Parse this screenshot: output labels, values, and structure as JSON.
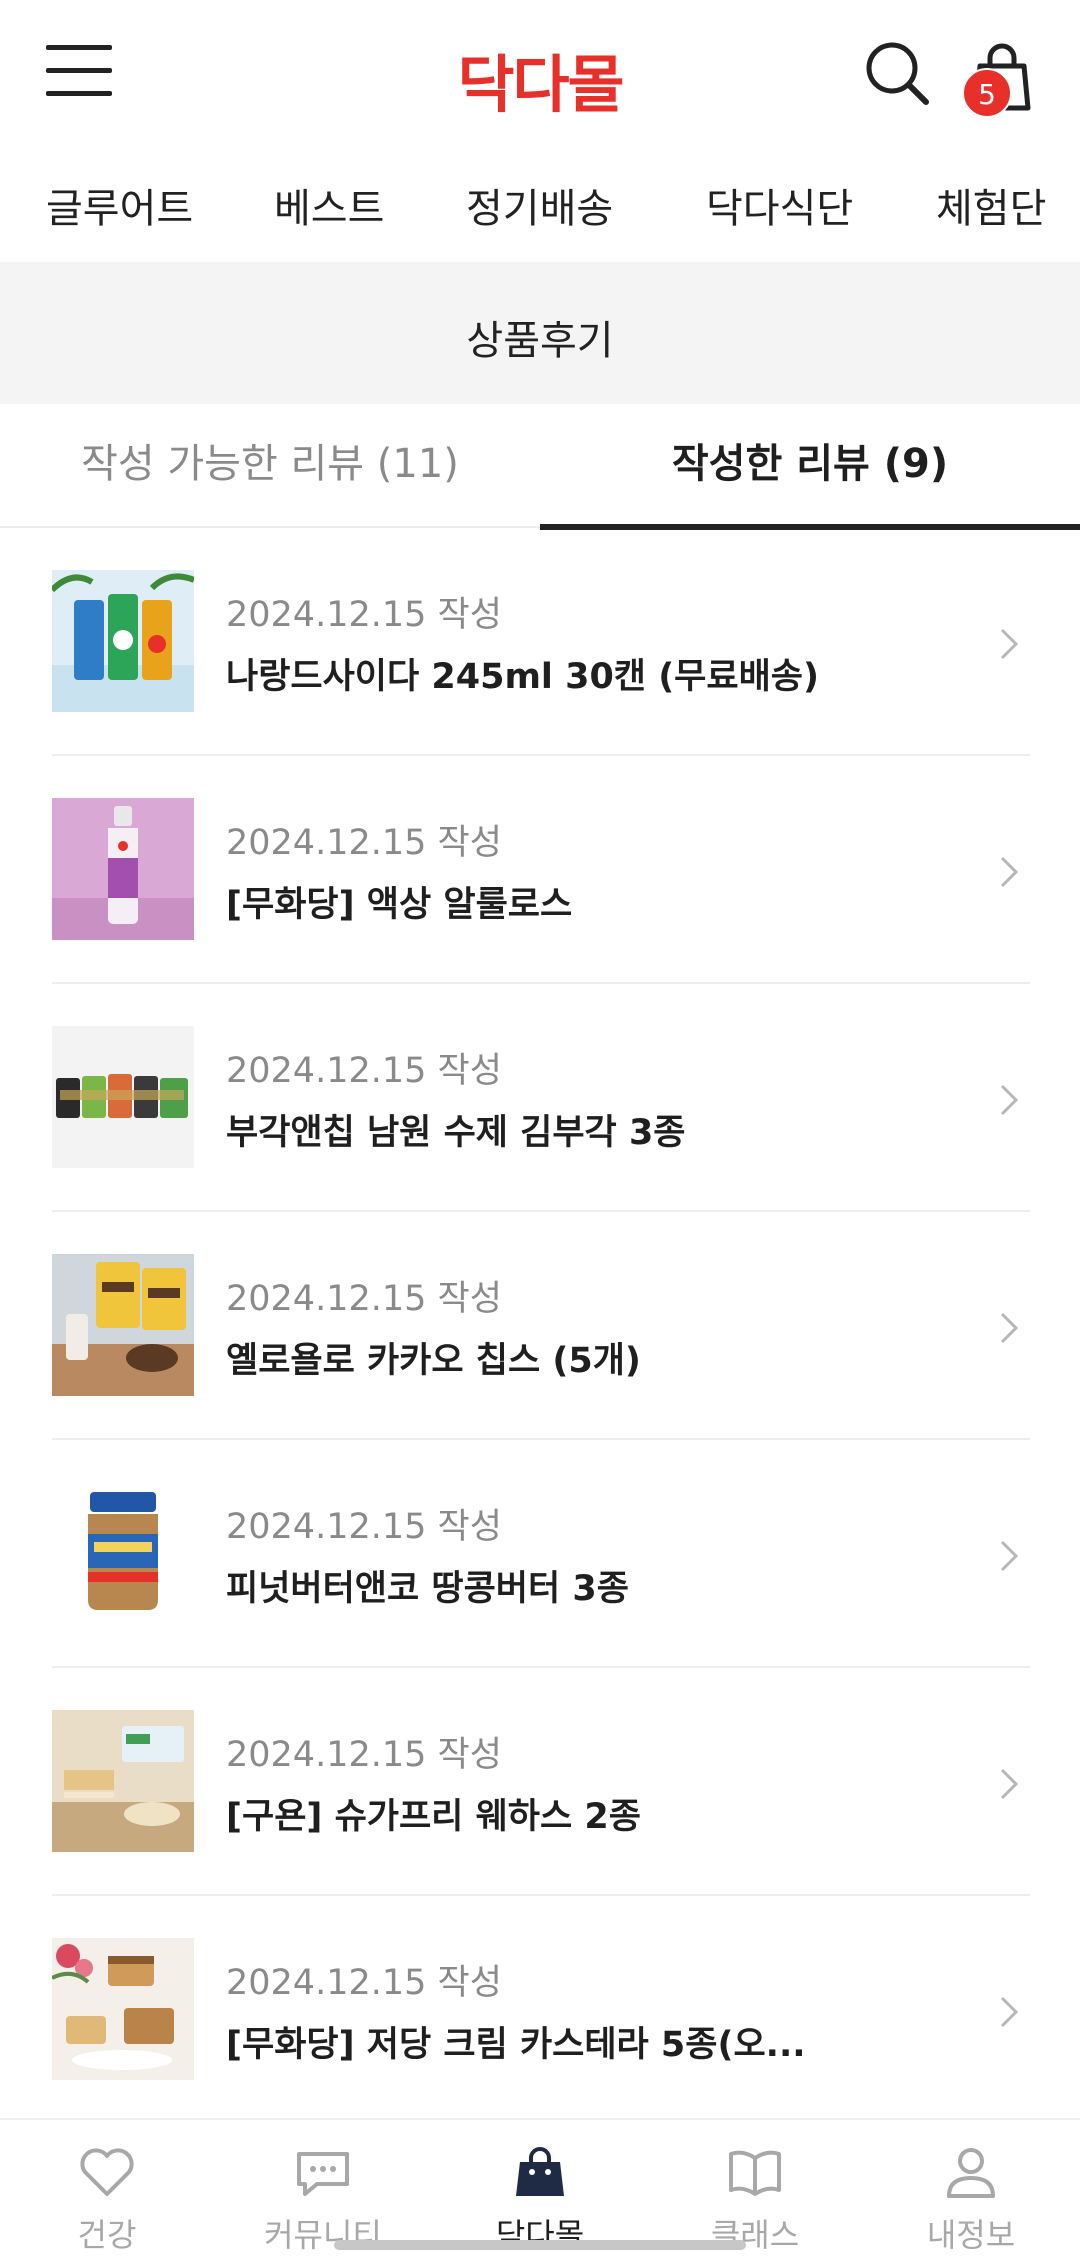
{
  "header": {
    "logo": "닥다몰",
    "cart_count": "5",
    "brand_color": "#e8302b"
  },
  "nav": {
    "items": [
      "글루어트",
      "베스트",
      "정기배송",
      "닥다식단",
      "체험단"
    ]
  },
  "page_title": "상품후기",
  "tabs": [
    {
      "label": "작성 가능한 리뷰 (11)",
      "active": false
    },
    {
      "label": "작성한 리뷰 (9)",
      "active": true
    }
  ],
  "reviews": [
    {
      "date": "2024.12.15 작성",
      "title": "나랑드사이다 245ml 30캔 (무료배송)",
      "thumb": "cider-cans-image"
    },
    {
      "date": "2024.12.15 작성",
      "title": "[무화당] 액상 알룰로스",
      "thumb": "allulose-bottle-image"
    },
    {
      "date": "2024.12.15 작성",
      "title": "부각앤칩 남원 수제 김부각 3종",
      "thumb": "seaweed-chips-image"
    },
    {
      "date": "2024.12.15 작성",
      "title": "옐로욜로 카카오 칩스 (5개)",
      "thumb": "cacao-chips-image"
    },
    {
      "date": "2024.12.15 작성",
      "title": "피넛버터앤코 땅콩버터 3종",
      "thumb": "peanut-butter-jar-image"
    },
    {
      "date": "2024.12.15 작성",
      "title": "[구욘] 슈가프리 웨하스 2종",
      "thumb": "wafer-image"
    },
    {
      "date": "2024.12.15 작성",
      "title": "[무화당] 저당 크림 카스테라 5종(오...",
      "thumb": "castella-cake-image"
    }
  ],
  "bottom_nav": [
    {
      "label": "건강",
      "icon": "heart-icon",
      "active": false
    },
    {
      "label": "커뮤니티",
      "icon": "chat-bubble-icon",
      "active": false
    },
    {
      "label": "닥다몰",
      "icon": "shopping-bag-icon",
      "active": true
    },
    {
      "label": "클래스",
      "icon": "book-icon",
      "active": false
    },
    {
      "label": "내정보",
      "icon": "person-icon",
      "active": false
    }
  ]
}
